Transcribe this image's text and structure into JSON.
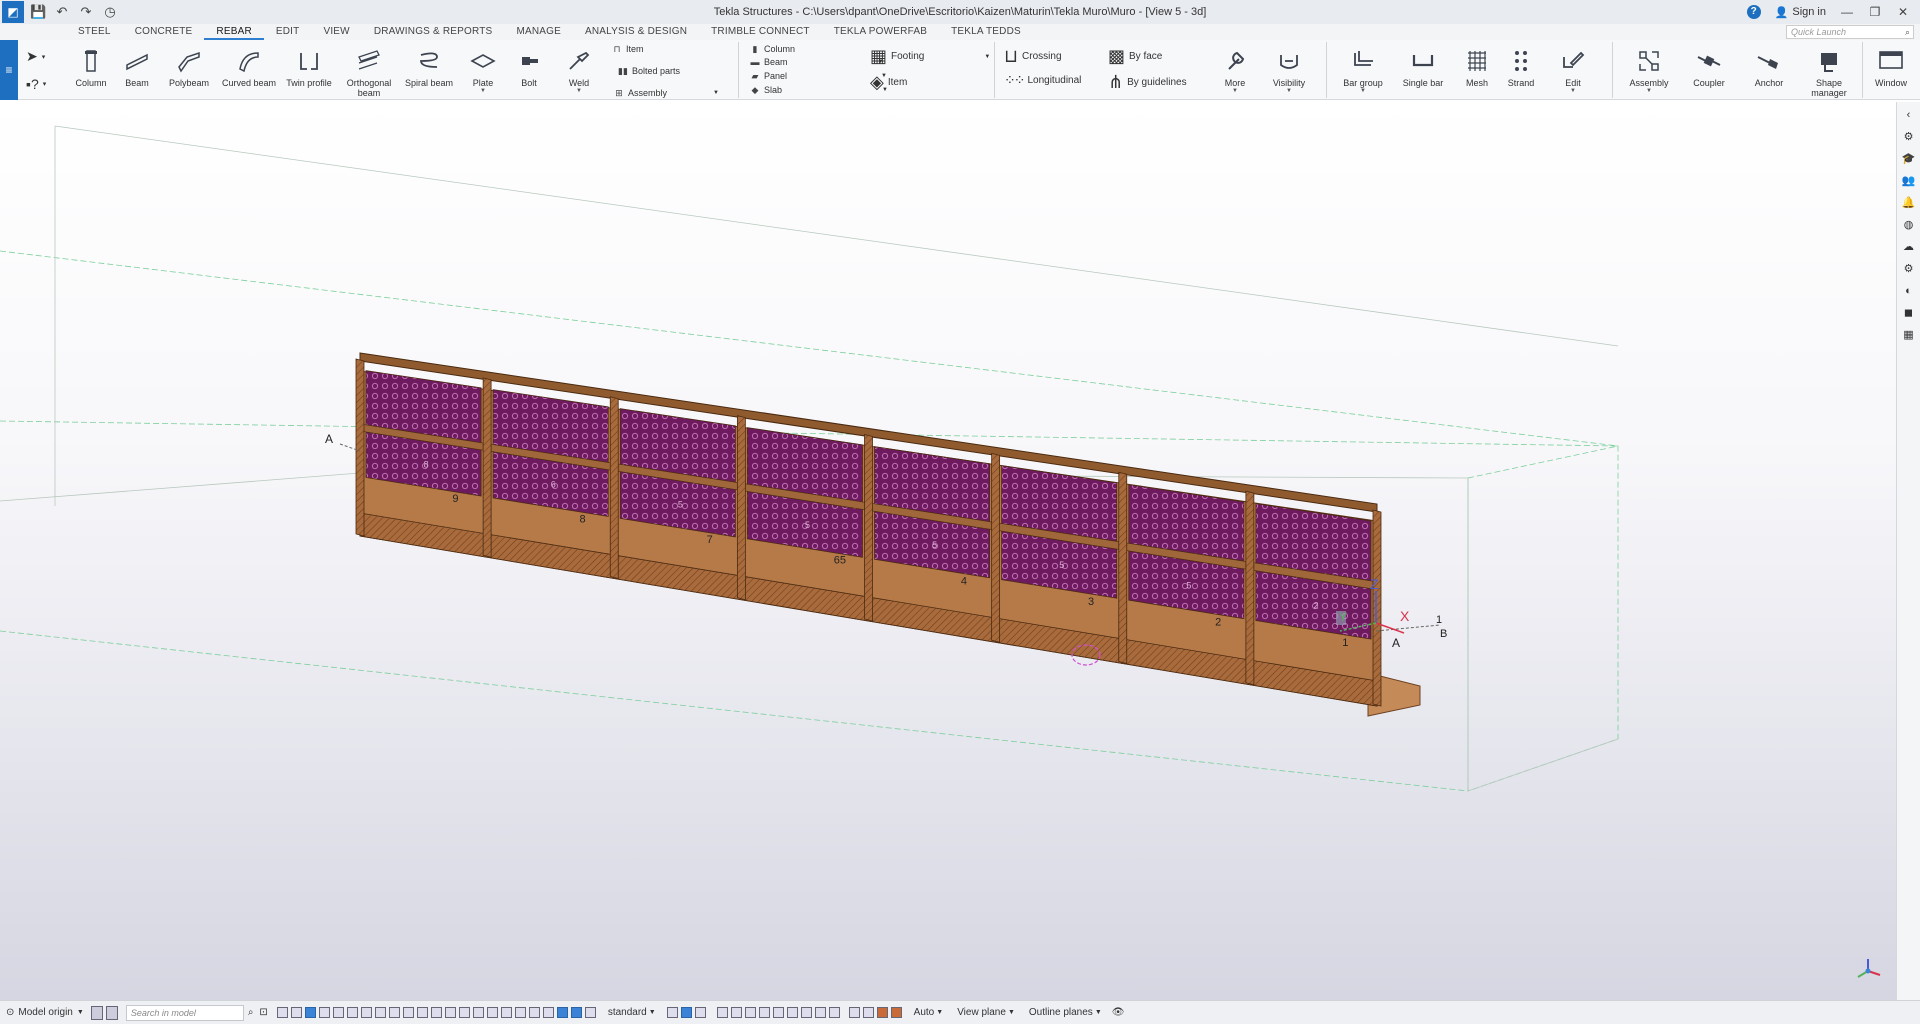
{
  "titlebar": {
    "title": "Tekla Structures - C:\\Users\\dpant\\OneDrive\\Escritorio\\Kaizen\\Maturin\\Tekla Muro\\Muro - [View 5 - 3d]",
    "sign_in": "Sign in",
    "help": "?"
  },
  "tabs": [
    "STEEL",
    "CONCRETE",
    "REBAR",
    "EDIT",
    "VIEW",
    "DRAWINGS & REPORTS",
    "MANAGE",
    "ANALYSIS & DESIGN",
    "TRIMBLE CONNECT",
    "TEKLA POWERFAB",
    "TEKLA TEDDS"
  ],
  "active_tab": "REBAR",
  "quick_launch": {
    "placeholder": "Quick Launch"
  },
  "ribbon": {
    "steel": [
      "Column",
      "Beam",
      "Polybeam",
      "Curved beam",
      "Twin profile",
      "Orthogonal beam",
      "Spiral beam",
      "Plate",
      "Bolt",
      "Weld"
    ],
    "weld_small": [
      "Item",
      "Bolted parts",
      "Assembly"
    ],
    "concrete_small": [
      "Column",
      "Beam",
      "Panel",
      "Slab"
    ],
    "concrete_large": [
      "Footing",
      "Item"
    ],
    "rebar_small": [
      "Crossing",
      "Longitudinal",
      "By face",
      "By guidelines"
    ],
    "rebar": [
      "More",
      "Visibility",
      "Bar group",
      "Single bar",
      "Mesh",
      "Strand",
      "Edit"
    ],
    "tools": [
      "Assembly",
      "Coupler",
      "Anchor",
      "Shape manager",
      "Window"
    ]
  },
  "model": {
    "bay_labels": [
      "9",
      "8",
      "7",
      "65",
      "4",
      "3",
      "2",
      "1"
    ],
    "upper_labels": [
      "8",
      "6",
      "5",
      "5",
      "5",
      "5",
      "5",
      "2"
    ],
    "grid_labels": [
      "A",
      "A",
      "1",
      "B"
    ],
    "axis_labels": [
      "X",
      "Y",
      "Z"
    ]
  },
  "statusbar": {
    "model_origin": "Model origin",
    "search_placeholder": "Search in model",
    "filter": "standard",
    "auto": "Auto",
    "view_plane": "View plane",
    "outline_planes": "Outline planes"
  },
  "colors": {
    "accent": "#2f7fd1",
    "concrete": "#b67a48",
    "mesh": "#7a1f6a",
    "ribbon_bg": "#f7f8fa"
  }
}
